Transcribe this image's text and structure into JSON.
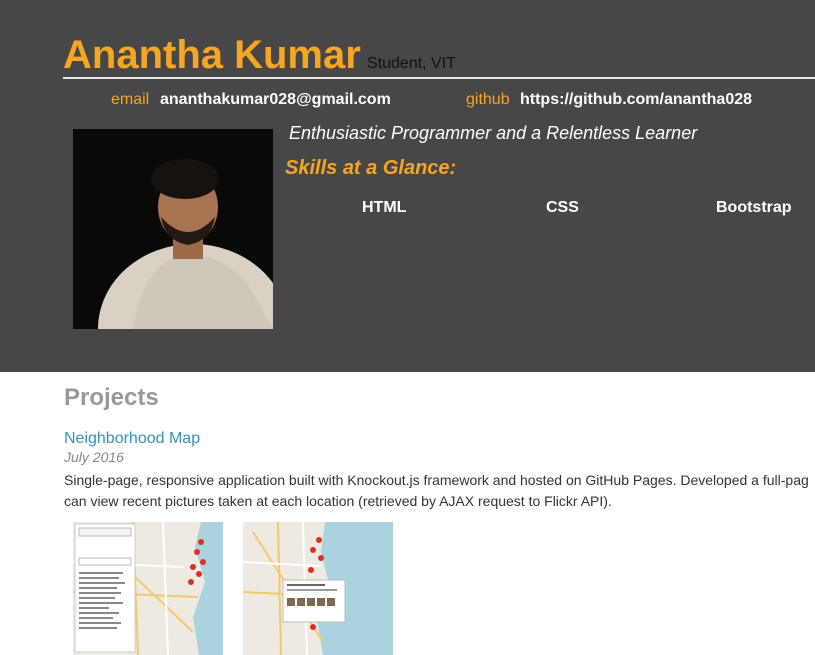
{
  "profile": {
    "name": "Anantha Kumar",
    "role": "Student, VIT",
    "email_label": "email",
    "email": "ananthakumar028@gmail.com",
    "github_label": "github",
    "github": "https://github.com/anantha028",
    "tagline": "Enthusiastic Programmer and a Relentless Learner"
  },
  "skills": {
    "title": "Skills at a Glance:",
    "items": [
      "HTML",
      "CSS",
      "Bootstrap"
    ]
  },
  "projects": {
    "title": "Projects",
    "items": [
      {
        "name": "Neighborhood Map",
        "date": "July 2016",
        "desc_line1": "Single-page, responsive application built with Knockout.js framework and hosted on GitHub Pages. Developed a full-pag",
        "desc_line2": "can view recent pictures taken at each location (retrieved by AJAX request to Flickr API)."
      }
    ]
  },
  "colors": {
    "header_bg": "#474747",
    "accent": "#f5a623",
    "link": "#3a8fb7"
  }
}
